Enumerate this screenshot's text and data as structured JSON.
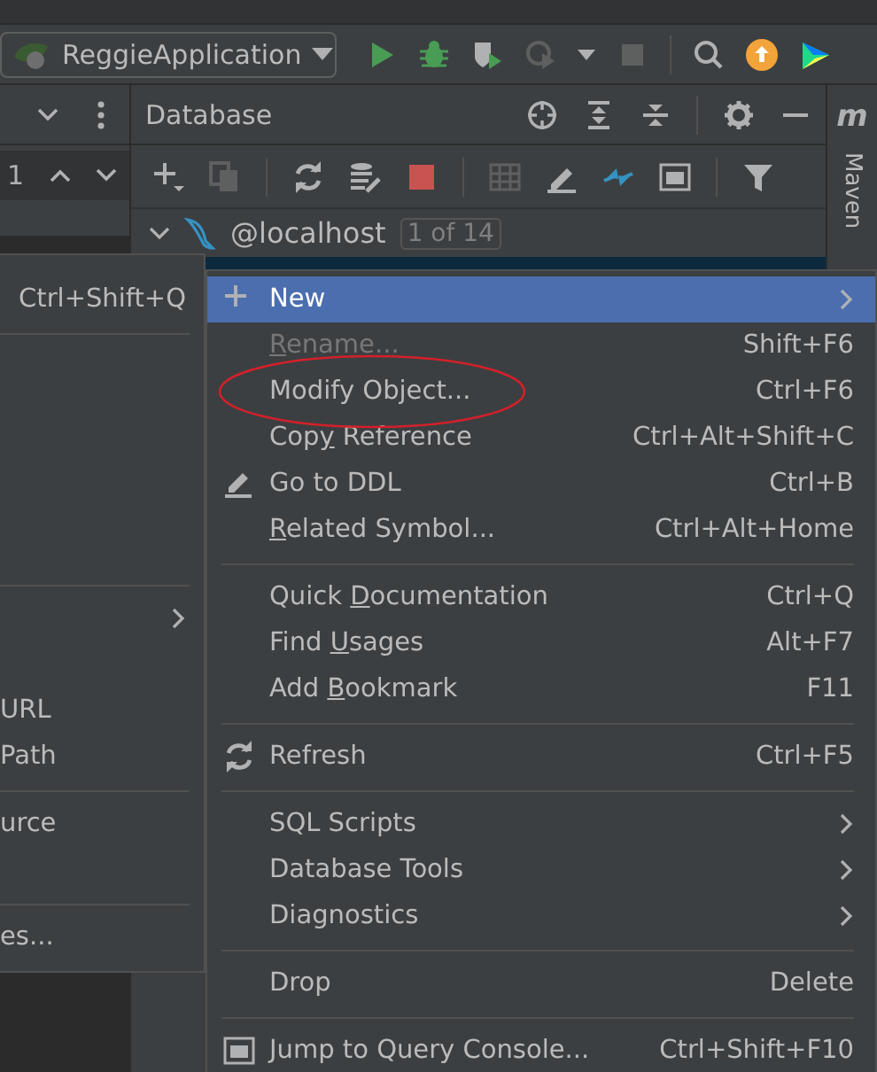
{
  "run_config": {
    "label": "ReggieApplication"
  },
  "left_panel": {
    "counter": "1"
  },
  "database_panel": {
    "title": "Database",
    "tree": [
      {
        "label": "@localhost",
        "badge": "1 of 14",
        "expanded": true
      }
    ]
  },
  "side_tab": {
    "letter": "m",
    "label": "Maven"
  },
  "back_menu": [
    {
      "kind": "item",
      "shortcut": "Ctrl+Shift+Q"
    },
    {
      "kind": "separator"
    },
    {
      "kind": "blank"
    },
    {
      "kind": "blank"
    },
    {
      "kind": "blank"
    },
    {
      "kind": "blank"
    },
    {
      "kind": "blank"
    },
    {
      "kind": "separator"
    },
    {
      "kind": "item",
      "submenu": true
    },
    {
      "kind": "blank"
    },
    {
      "kind": "item",
      "label": "URL"
    },
    {
      "kind": "item",
      "label": "Path"
    },
    {
      "kind": "separator"
    },
    {
      "kind": "item",
      "label": "urce"
    },
    {
      "kind": "blank"
    },
    {
      "kind": "separator"
    },
    {
      "kind": "item",
      "label": "es..."
    }
  ],
  "context_menu": [
    {
      "kind": "item",
      "label": "New",
      "submenu": true,
      "selected": true,
      "disabled": false,
      "circled": false
    },
    {
      "kind": "item",
      "mnemonic": "R",
      "label_rest": "ename...",
      "shortcut": "Shift+F6",
      "submenu": false,
      "selected": false,
      "disabled": true,
      "circled": false
    },
    {
      "kind": "item",
      "label": "Modify Object...",
      "shortcut": "Ctrl+F6",
      "submenu": false,
      "selected": false,
      "disabled": false,
      "circled": true
    },
    {
      "kind": "item",
      "label_lead": "Cop",
      "mnemonic": "y",
      "label_rest": " Reference",
      "shortcut": "Ctrl+Alt+Shift+C",
      "submenu": false,
      "selected": false,
      "disabled": false,
      "circled": false
    },
    {
      "kind": "item",
      "label": "Go to DDL",
      "shortcut": "Ctrl+B",
      "submenu": false,
      "selected": false,
      "disabled": false,
      "circled": false
    },
    {
      "kind": "item",
      "mnemonic": "R",
      "label_rest": "elated Symbol...",
      "shortcut": "Ctrl+Alt+Home",
      "submenu": false,
      "selected": false,
      "disabled": false,
      "circled": false
    },
    {
      "kind": "separator"
    },
    {
      "kind": "item",
      "label_lead": "Quick ",
      "mnemonic": "D",
      "label_rest": "ocumentation",
      "shortcut": "Ctrl+Q",
      "submenu": false,
      "selected": false,
      "disabled": false,
      "circled": false
    },
    {
      "kind": "item",
      "label_lead": "Find ",
      "mnemonic": "U",
      "label_rest": "sages",
      "shortcut": "Alt+F7",
      "submenu": false,
      "selected": false,
      "disabled": false,
      "circled": false
    },
    {
      "kind": "item",
      "label_lead": "Add ",
      "mnemonic": "B",
      "label_rest": "ookmark",
      "shortcut": "F11",
      "submenu": false,
      "selected": false,
      "disabled": false,
      "circled": false
    },
    {
      "kind": "separator"
    },
    {
      "kind": "item",
      "label": "Refresh",
      "shortcut": "Ctrl+F5",
      "submenu": false,
      "selected": false,
      "disabled": false,
      "circled": false
    },
    {
      "kind": "separator"
    },
    {
      "kind": "item",
      "label": "SQL Scripts",
      "submenu": true,
      "selected": false,
      "disabled": false,
      "circled": false
    },
    {
      "kind": "item",
      "label": "Database Tools",
      "submenu": true,
      "selected": false,
      "disabled": false,
      "circled": false
    },
    {
      "kind": "item",
      "label": "Diagnostics",
      "submenu": true,
      "selected": false,
      "disabled": false,
      "circled": false
    },
    {
      "kind": "separator"
    },
    {
      "kind": "item",
      "label": "Drop",
      "shortcut": "Delete",
      "submenu": false,
      "selected": false,
      "disabled": false,
      "circled": false
    },
    {
      "kind": "separator"
    },
    {
      "kind": "item",
      "label": "Jump to Query Console...",
      "shortcut": "Ctrl+Shift+F10",
      "submenu": false,
      "selected": false,
      "disabled": false,
      "circled": false
    }
  ]
}
